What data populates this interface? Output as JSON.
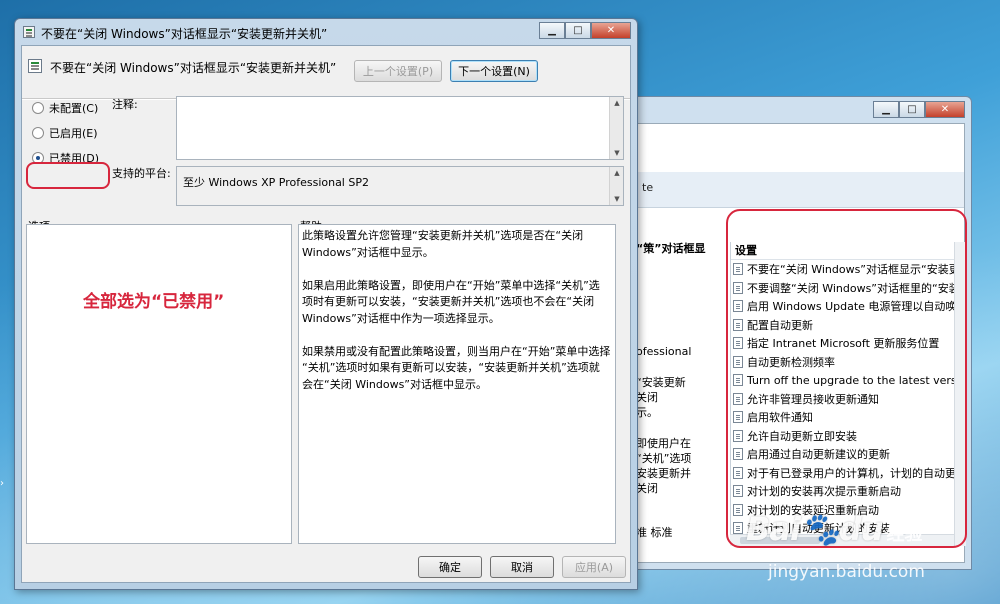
{
  "bg_window": {
    "band_text": "te",
    "column_header": "“策”对话框显",
    "description_lines": [
      "ofessional",
      "“安装更新",
      "关闭",
      "示。",
      "即使用户在",
      "“关机”选项",
      "安装更新并",
      "关闭"
    ],
    "tabs_text": "准    标准",
    "list_header": "设置",
    "list_items": [
      "不要在“关闭 Windows”对话框显示“安装更",
      "不要调整“关闭 Windows”对话框里的“安装",
      "启用 Windows Update 电源管理以自动唤醒",
      "配置自动更新",
      "指定 Intranet Microsoft 更新服务位置",
      "自动更新检测频率",
      "Turn off the upgrade to the latest version",
      "允许非管理员接收更新通知",
      "启用软件通知",
      "允许自动更新立即安装",
      "启用通过自动更新建议的更新",
      "对于有已登录用户的计算机，计划的自动更新",
      "对计划的安装再次提示重新启动",
      "对计划的安装延迟重新启动",
      "重新计划自动更新计划的安装"
    ]
  },
  "dialog": {
    "title": "不要在“关闭 Windows”对话框显示“安装更新并关机”",
    "header_title": "不要在“关闭 Windows”对话框显示“安装更新并关机”",
    "prev_button": "上一个设置(P)",
    "next_button": "下一个设置(N)",
    "radios": {
      "not_configured": "未配置(C)",
      "enabled": "已启用(E)",
      "disabled": "已禁用(D)",
      "selected": "disabled"
    },
    "comment_label": "注释:",
    "platform_label": "支持的平台:",
    "platform_value": "至少 Windows XP Professional SP2",
    "options_label": "选项:",
    "help_label": "帮助:",
    "annotation": "全部选为“已禁用”",
    "help_lines": [
      "此策略设置允许您管理“安装更新并关机”选项是否在“关闭",
      "Windows”对话框中显示。",
      "如果启用此策略设置，即使用户在“开始”菜单中选择“关机”选",
      "项时有更新可以安装，“安装更新并关机”选项也不会在“关闭",
      "Windows”对话框中作为一项选择显示。",
      "如果禁用或没有配置此策略设置，则当用户在“开始”菜单中选择",
      "“关机”选项时如果有更新可以安装，“安装更新并关机”选项就",
      "会在“关闭 Windows”对话框中显示。"
    ],
    "ok_button": "确定",
    "cancel_button": "取消",
    "apply_button": "应用(A)"
  },
  "watermark": {
    "logo": "Bai",
    "logo_tail": "du",
    "sub": "经验",
    "url": "jingyan.baidu.com"
  },
  "icons": [
    "window-controls",
    "policy-doc-icon",
    "radio-button"
  ],
  "colors": {
    "annotation_red": "#d7263d",
    "title_blue": "#c6d9ea"
  }
}
